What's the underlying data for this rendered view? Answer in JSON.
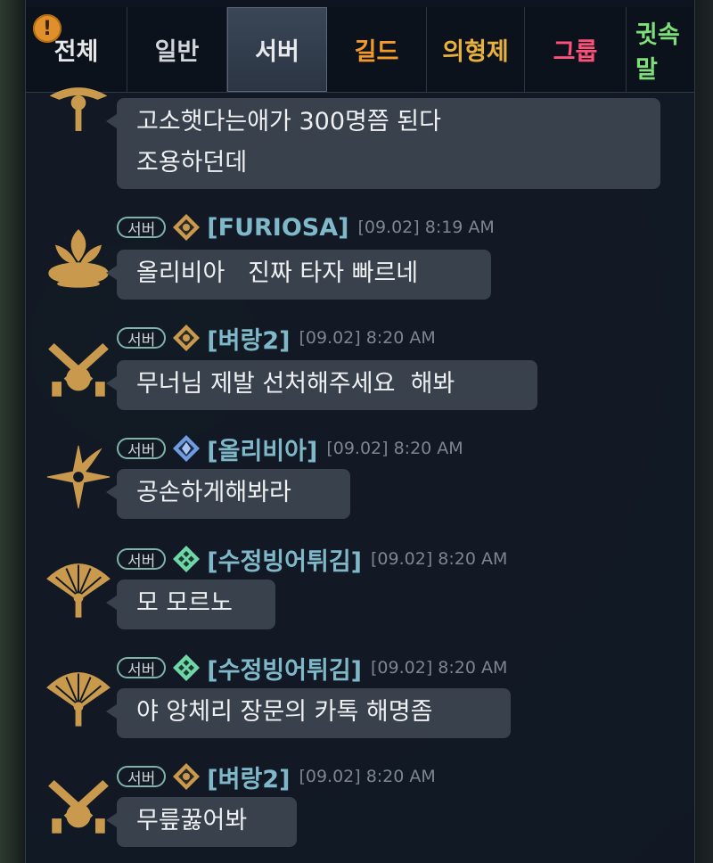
{
  "tabs": [
    {
      "label": "전체",
      "color": "#e6e8ea"
    },
    {
      "label": "일반",
      "color": "#d2d5d9"
    },
    {
      "label": "서버",
      "color": "#e8eaee"
    },
    {
      "label": "길드",
      "color": "#f39a2b"
    },
    {
      "label": "의형제",
      "color": "#e8b03c"
    },
    {
      "label": "그룹",
      "color": "#ff4f7b"
    },
    {
      "label": "귓속말",
      "color": "#7ee07a"
    }
  ],
  "active_tab": "서버",
  "alert_icon": "exclamation-icon",
  "messages": [
    {
      "avatar": "gunslinger-emblem-icon",
      "badge": "서버",
      "class_icon": "class-crest-icon",
      "sender": "",
      "time": "",
      "text": "고소햇다는애가 300명쯤 된다\n조용하던데"
    },
    {
      "avatar": "lotus-emblem-icon",
      "badge": "서버",
      "class_icon": "class-crest-icon",
      "sender": "[FURIOSA]",
      "time": "[09.02] 8:19 AM",
      "text": "올리비아   진짜 타자 빠르네"
    },
    {
      "avatar": "crossed-guns-emblem-icon",
      "badge": "서버",
      "class_icon": "class-crest-icon",
      "sender": "[벼랑2]",
      "time": "[09.02] 8:20 AM",
      "text": "무너님 제발 선처해주세요  해봐"
    },
    {
      "avatar": "star-bird-emblem-icon",
      "badge": "서버",
      "class_icon": "blue-crest-icon",
      "sender": "[올리비아]",
      "time": "[09.02] 8:20 AM",
      "text": "공손하게해봐라"
    },
    {
      "avatar": "fan-emblem-icon",
      "badge": "서버",
      "class_icon": "green-crest-icon",
      "sender": "[수정빙어튀김]",
      "time": "[09.02] 8:20 AM",
      "text": "모 모르노"
    },
    {
      "avatar": "fan-emblem-icon",
      "badge": "서버",
      "class_icon": "green-crest-icon",
      "sender": "[수정빙어튀김]",
      "time": "[09.02] 8:20 AM",
      "text": "야 앙체리 장문의 카톡 해명좀"
    },
    {
      "avatar": "crossed-guns-emblem-icon",
      "badge": "서버",
      "class_icon": "class-crest-icon",
      "sender": "[벼랑2]",
      "time": "[09.02] 8:20 AM",
      "text": "무릎꿇어봐"
    }
  ]
}
